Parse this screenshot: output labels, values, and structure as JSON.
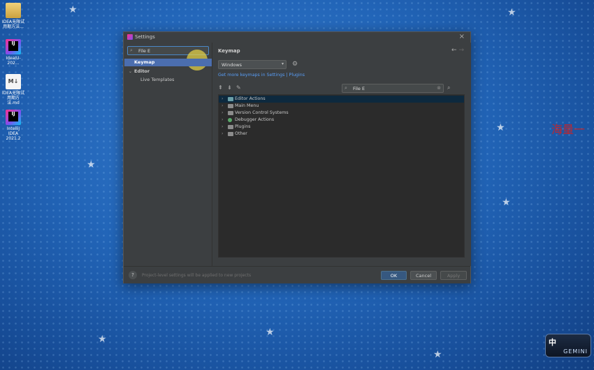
{
  "desktop": {
    "icons": [
      {
        "label": "IDEA无限试\n用期方法...",
        "icon": "folder-icon"
      },
      {
        "label": "IdeaIU-202...",
        "icon": "intellij-installer-icon"
      },
      {
        "label": "IDEA无限试\n用期方法.md",
        "icon": "markdown-file-icon"
      },
      {
        "label": "IntelliJ IDEA\n2021.2",
        "icon": "intellij-idea-icon"
      }
    ],
    "side_text": "海量一",
    "ime": {
      "char": "中",
      "brand": "GEMINI"
    }
  },
  "dialog": {
    "title": "Settings",
    "close_glyph": "×",
    "search": {
      "value": "File E",
      "glyph": "⌕"
    },
    "nav": [
      {
        "label": "Keymap"
      },
      {
        "label": "Editor"
      },
      {
        "label": "Live Templates"
      }
    ],
    "right": {
      "title": "Keymap",
      "keymap_select": "Windows",
      "link_text": "Get more keymaps in Settings | Plugins",
      "filter_value": "File E",
      "tree": [
        {
          "label": "Editor Actions"
        },
        {
          "label": "Main Menu"
        },
        {
          "label": "Version Control Systems"
        },
        {
          "label": "Debugger Actions"
        },
        {
          "label": "Plugins"
        },
        {
          "label": "Other"
        }
      ]
    },
    "footer": {
      "hint": "Project-level settings will be applied to new projects",
      "help": "?",
      "ok": "OK",
      "cancel": "Cancel",
      "apply": "Apply"
    }
  },
  "colors": {
    "accent": "#4b6eaf",
    "link": "#589df6",
    "ok_button": "#365880",
    "desktop": "#2265b8"
  }
}
